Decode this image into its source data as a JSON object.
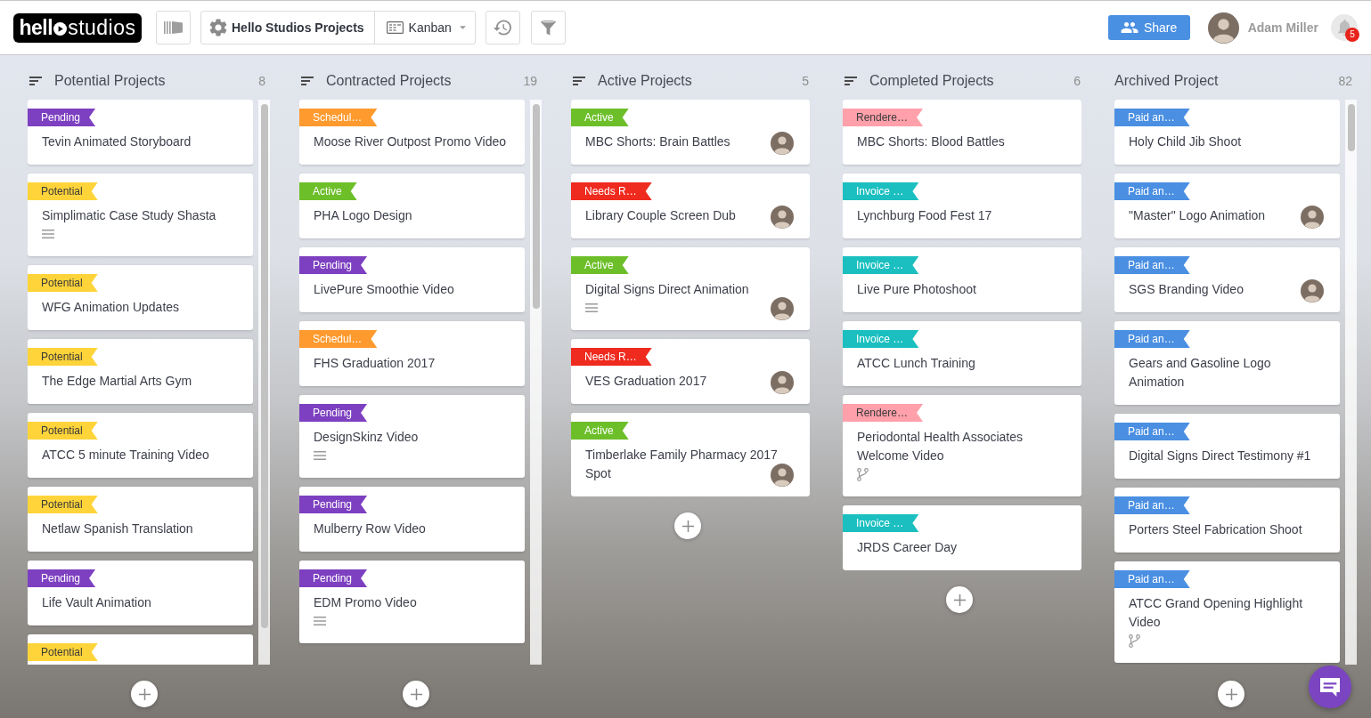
{
  "toolbar": {
    "logo": {
      "bold_part": "hell",
      "light_part": "studios"
    },
    "project_name": "Hello Studios Projects",
    "view": "Kanban",
    "share_label": "Share",
    "user_name": "Adam Miller",
    "notification_count": "5"
  },
  "columns": [
    {
      "title": "Potential Projects",
      "count": "8",
      "sort_icon": true,
      "cards": [
        {
          "kind": "plain",
          "tag": {
            "label": "Pending",
            "color": "#7d40c0"
          },
          "title": "Tevin Animated Storyboard",
          "avatar": false
        },
        {
          "kind": "notes",
          "tag": {
            "label": "Potential",
            "color": "#ffd43a"
          },
          "title": "Simplimatic Case Study Shasta",
          "avatar": false
        },
        {
          "kind": "plain",
          "tag": {
            "label": "Potential",
            "color": "#ffd43a"
          },
          "title": "WFG Animation Updates",
          "avatar": false
        },
        {
          "kind": "plain",
          "tag": {
            "label": "Potential",
            "color": "#ffd43a"
          },
          "title": "The Edge Martial Arts Gym",
          "avatar": false
        },
        {
          "kind": "plain",
          "tag": {
            "label": "Potential",
            "color": "#ffd43a"
          },
          "title": "ATCC 5 minute Training Video",
          "avatar": false
        },
        {
          "kind": "plain",
          "tag": {
            "label": "Potential",
            "color": "#ffd43a"
          },
          "title": "Netlaw Spanish Translation",
          "avatar": false
        },
        {
          "kind": "plain",
          "tag": {
            "label": "Pending",
            "color": "#7d40c0"
          },
          "title": "Life Vault Animation",
          "avatar": false
        },
        {
          "kind": "plain",
          "tag": {
            "label": "Potential",
            "color": "#ffd43a"
          },
          "avatar": false
        }
      ]
    },
    {
      "title": "Contracted Projects",
      "count": "19",
      "sort_icon": true,
      "cards": [
        {
          "kind": "plain",
          "tag": {
            "label": "Schedul…",
            "color": "#ff9a2e"
          },
          "title": "Moose River Outpost Promo Video",
          "avatar": false
        },
        {
          "kind": "plain",
          "tag": {
            "label": "Active",
            "color": "#6dbf2a"
          },
          "title": "PHA Logo Design",
          "avatar": false
        },
        {
          "kind": "plain",
          "tag": {
            "label": "Pending",
            "color": "#7d40c0"
          },
          "title": "LivePure Smoothie Video",
          "avatar": false
        },
        {
          "kind": "plain",
          "tag": {
            "label": "Schedul…",
            "color": "#ff9a2e"
          },
          "title": "FHS Graduation 2017",
          "avatar": false
        },
        {
          "kind": "notes",
          "tag": {
            "label": "Pending",
            "color": "#7d40c0"
          },
          "title": "DesignSkinz Video",
          "avatar": false
        },
        {
          "kind": "plain",
          "tag": {
            "label": "Pending",
            "color": "#7d40c0"
          },
          "title": "Mulberry Row Video",
          "avatar": false
        },
        {
          "kind": "notes",
          "tag": {
            "label": "Pending",
            "color": "#7d40c0"
          },
          "title": "EDM Promo Video",
          "avatar": false
        }
      ]
    },
    {
      "title": "Active Projects",
      "count": "5",
      "sort_icon": true,
      "cards": [
        {
          "kind": "plain",
          "tag": {
            "label": "Active",
            "color": "#6dbf2a"
          },
          "title": "MBC Shorts: Brain Battles",
          "avatar": true
        },
        {
          "kind": "plain",
          "tag": {
            "label": "Needs R…",
            "color": "#ef2a1e"
          },
          "title": "Library Couple Screen Dub",
          "avatar": true
        },
        {
          "kind": "notes",
          "tag": {
            "label": "Active",
            "color": "#6dbf2a"
          },
          "title": "Digital Signs Direct Animation",
          "avatar": true
        },
        {
          "kind": "plain",
          "tag": {
            "label": "Needs R…",
            "color": "#ef2a1e"
          },
          "title": "VES Graduation 2017",
          "avatar": true
        },
        {
          "kind": "plain",
          "tag": {
            "label": "Active",
            "color": "#6dbf2a"
          },
          "title": "Timberlake Family Pharmacy 2017 Spot",
          "avatar": true
        }
      ]
    },
    {
      "title": "Completed Projects",
      "count": "6",
      "sort_icon": true,
      "cards": [
        {
          "kind": "plain",
          "tag": {
            "label": "Rendere…",
            "color": "#ffa0aa"
          },
          "title": "MBC Shorts: Blood Battles",
          "avatar": false
        },
        {
          "kind": "plain",
          "tag": {
            "label": "Invoice …",
            "color": "#1bbfc0"
          },
          "title": "Lynchburg Food Fest 17",
          "avatar": false
        },
        {
          "kind": "plain",
          "tag": {
            "label": "Invoice …",
            "color": "#1bbfc0"
          },
          "title": "Live Pure Photoshoot",
          "avatar": false
        },
        {
          "kind": "plain",
          "tag": {
            "label": "Invoice …",
            "color": "#1bbfc0"
          },
          "title": "ATCC Lunch Training",
          "avatar": false
        },
        {
          "kind": "branch",
          "tag": {
            "label": "Rendere…",
            "color": "#ffa0aa"
          },
          "title": "Periodontal Health Associates Welcome Video",
          "avatar": false
        },
        {
          "kind": "plain",
          "tag": {
            "label": "Invoice …",
            "color": "#1bbfc0"
          },
          "title": "JRDS Career Day",
          "avatar": false
        }
      ]
    },
    {
      "title": "Archived Project",
      "count": "82",
      "sort_icon": false,
      "cards": [
        {
          "kind": "plain",
          "tag": {
            "label": "Paid an…",
            "color": "#4a8fe2"
          },
          "title": "Holy Child Jib Shoot",
          "avatar": false
        },
        {
          "kind": "plain",
          "tag": {
            "label": "Paid an…",
            "color": "#4a8fe2"
          },
          "title": "\"Master\" Logo Animation",
          "avatar": true
        },
        {
          "kind": "plain",
          "tag": {
            "label": "Paid an…",
            "color": "#4a8fe2"
          },
          "title": "SGS Branding Video",
          "avatar": true
        },
        {
          "kind": "plain",
          "tag": {
            "label": "Paid an…",
            "color": "#4a8fe2"
          },
          "title": "Gears and Gasoline Logo Animation",
          "avatar": false
        },
        {
          "kind": "plain",
          "tag": {
            "label": "Paid an…",
            "color": "#4a8fe2"
          },
          "title": "Digital Signs Direct Testimony #1",
          "avatar": false
        },
        {
          "kind": "plain",
          "tag": {
            "label": "Paid an…",
            "color": "#4a8fe2"
          },
          "title": "Porters Steel Fabrication Shoot",
          "avatar": false
        },
        {
          "kind": "branch",
          "tag": {
            "label": "Paid an…",
            "color": "#4a8fe2"
          },
          "title": "ATCC Grand Opening Highlight Video",
          "avatar": false
        }
      ]
    }
  ]
}
